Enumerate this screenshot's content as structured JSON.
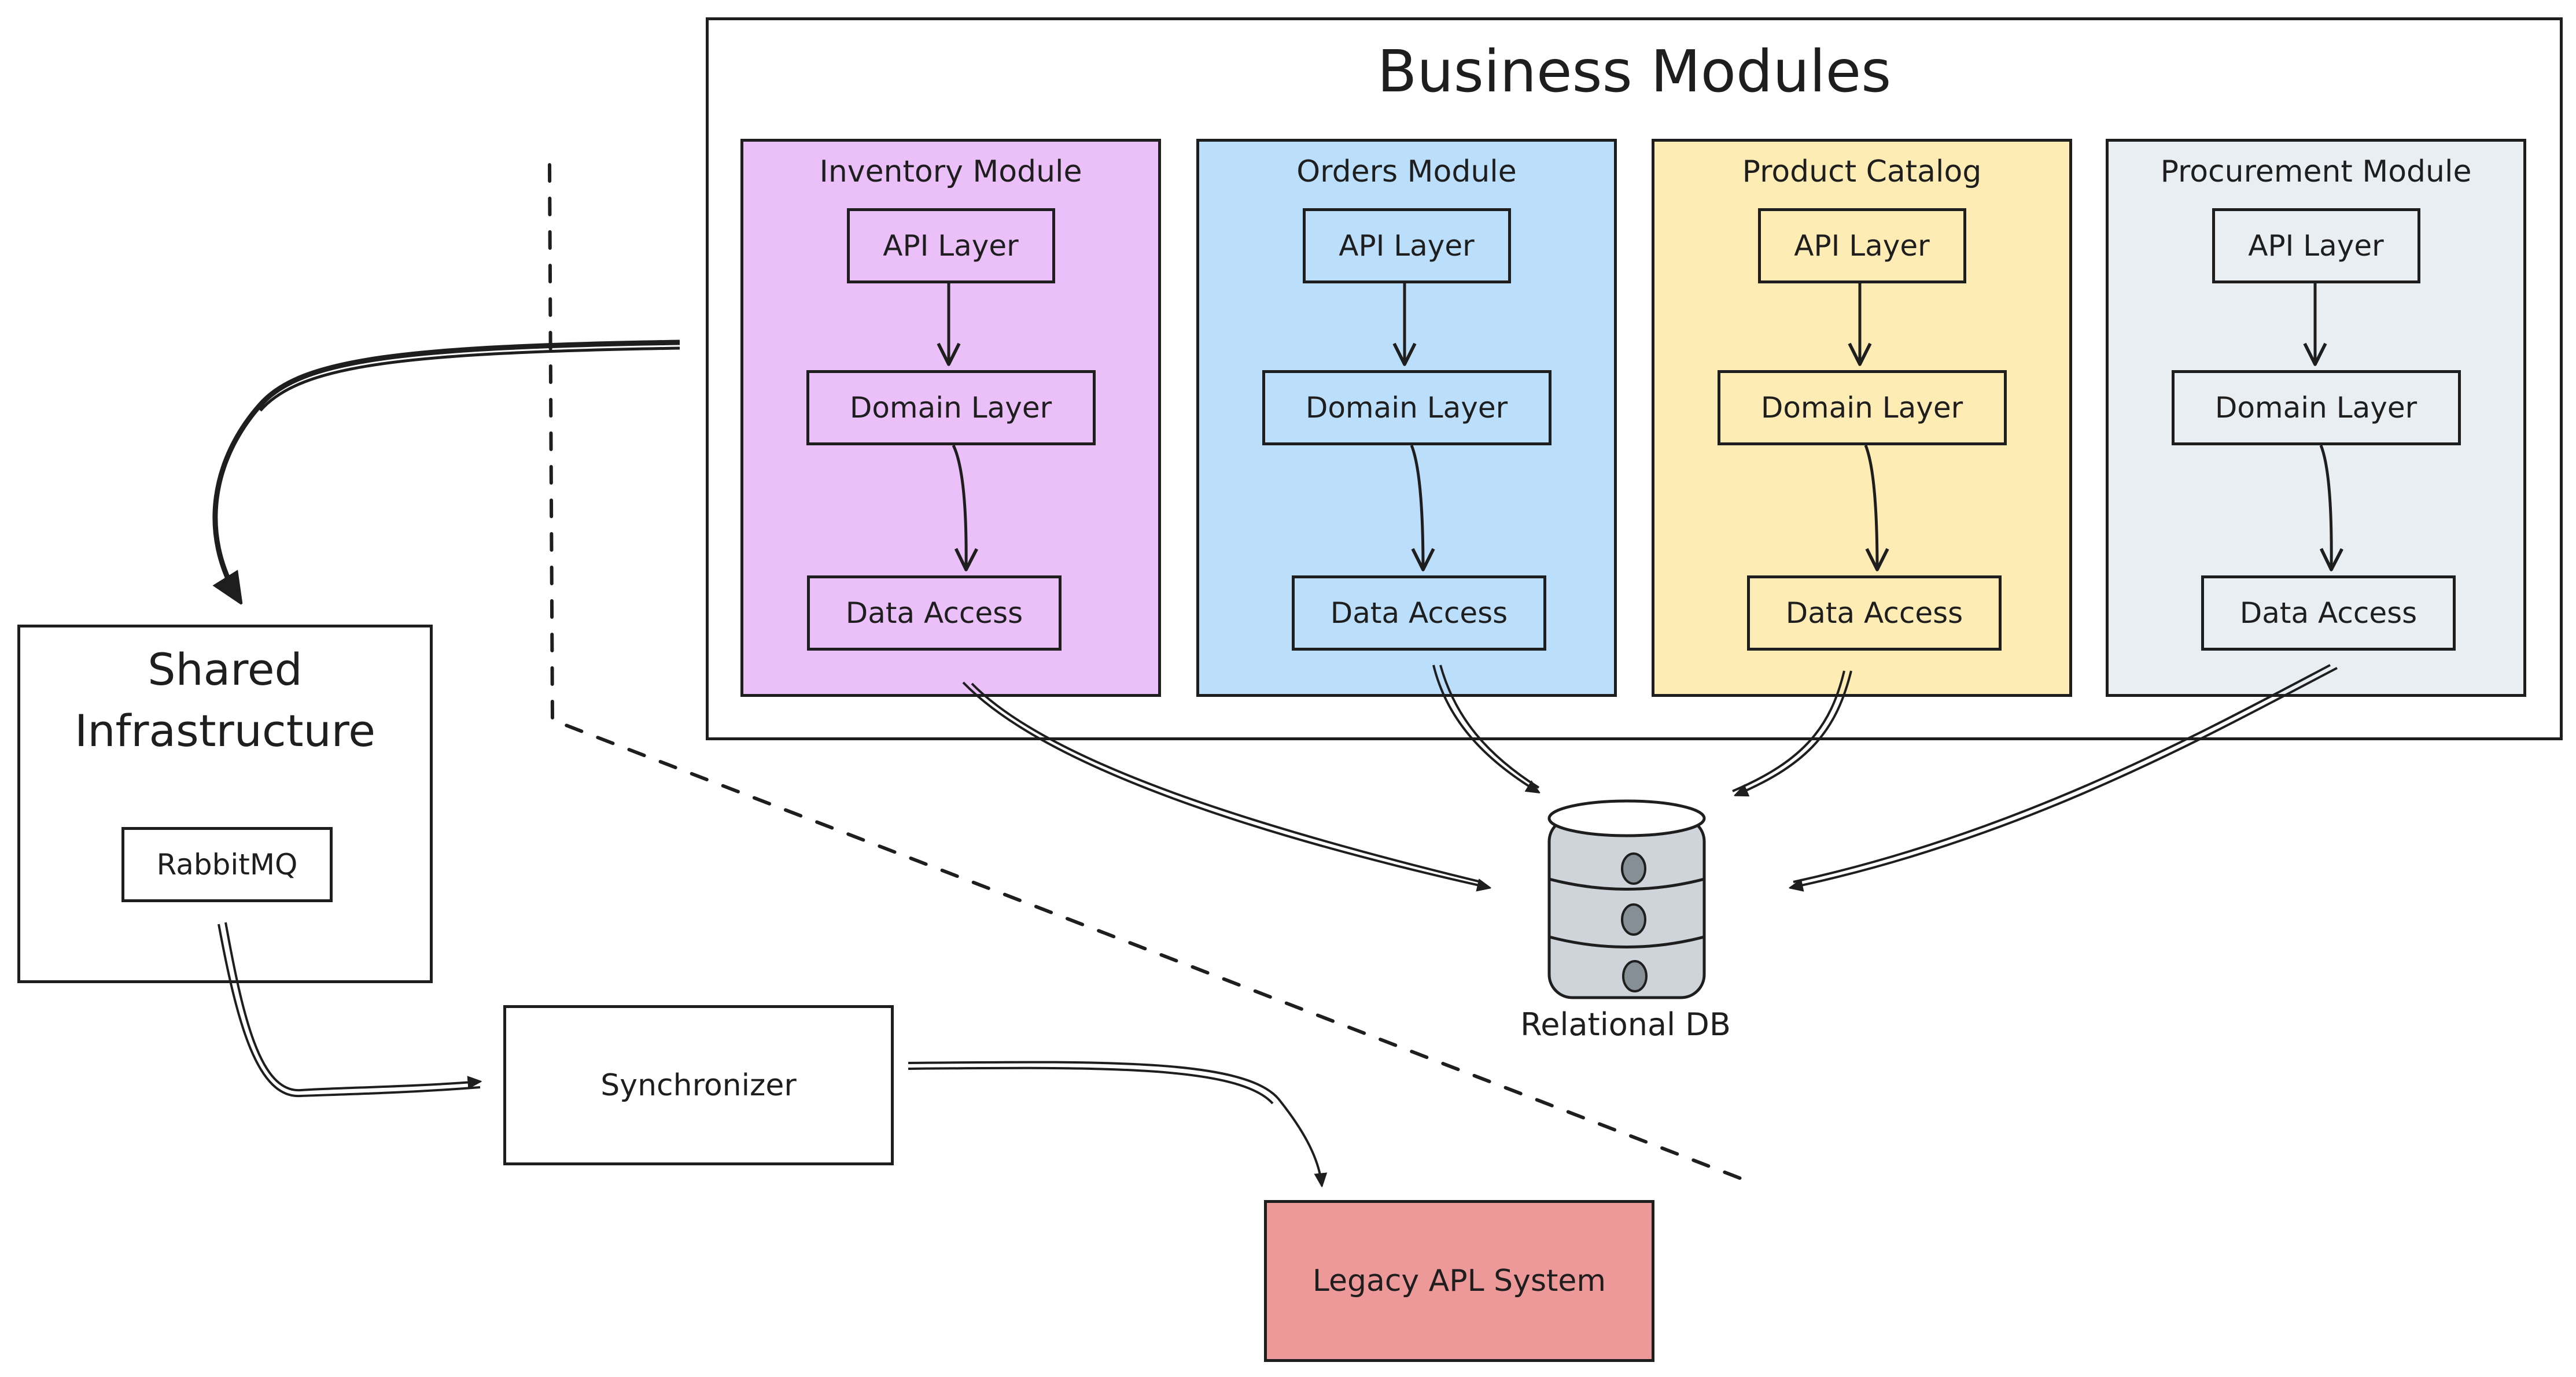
{
  "diagram": {
    "frame": {
      "title": "Business Modules"
    },
    "modules": [
      {
        "id": "inventory",
        "title": "Inventory Module",
        "fill": "#ebc0f9",
        "layers": [
          "API Layer",
          "Domain Layer",
          "Data Access"
        ]
      },
      {
        "id": "orders",
        "title": "Orders Module",
        "fill": "#bbdefa",
        "layers": [
          "API Layer",
          "Domain Layer",
          "Data Access"
        ]
      },
      {
        "id": "product-catalog",
        "title": "Product Catalog",
        "fill": "#feecb5",
        "layers": [
          "API Layer",
          "Domain Layer",
          "Data Access"
        ]
      },
      {
        "id": "procurement",
        "title": "Procurement Module",
        "fill": "#e9eef2",
        "layers": [
          "API Layer",
          "Domain Layer",
          "Data Access"
        ]
      }
    ],
    "shared": {
      "title": "Shared Infrastructure",
      "child": "RabbitMQ"
    },
    "synchronizer": {
      "label": "Synchronizer"
    },
    "legacy": {
      "label": "Legacy APL System",
      "fill": "#ee9999"
    },
    "database": {
      "label": "Relational DB",
      "body_fill": "#ced4da",
      "dot_fill": "#868e96"
    },
    "connections": [
      {
        "from": "Business Modules",
        "to": "Shared Infrastructure"
      },
      {
        "from": "Inventory Data Access",
        "to": "Relational DB"
      },
      {
        "from": "Orders Data Access",
        "to": "Relational DB"
      },
      {
        "from": "Product Catalog Data Access",
        "to": "Relational DB"
      },
      {
        "from": "Procurement Data Access",
        "to": "Relational DB"
      },
      {
        "from": "RabbitMQ",
        "to": "Synchronizer"
      },
      {
        "from": "Synchronizer",
        "to": "Legacy APL System"
      }
    ],
    "boundary": {
      "style": "dashed"
    }
  }
}
